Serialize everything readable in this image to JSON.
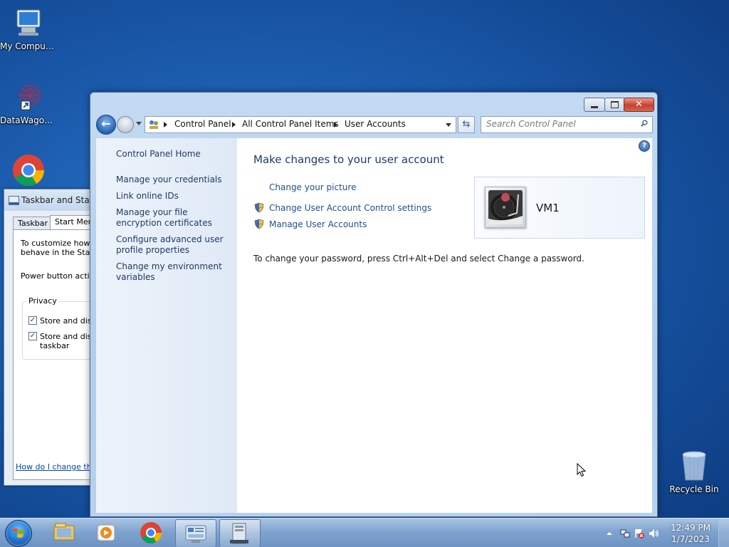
{
  "desktop": {
    "icons": [
      {
        "label": "My Computer",
        "icon": "computer-icon"
      },
      {
        "label": "DataWagon...",
        "icon": "datawagon-icon"
      },
      {
        "label": "",
        "icon": "chrome-icon"
      },
      {
        "label": "Recycle Bin",
        "icon": "recycle-bin-icon"
      }
    ]
  },
  "taskbar_props": {
    "title": "Taskbar and Start",
    "tabs": [
      "Taskbar",
      "Start Menu"
    ],
    "active_tab": "Start Menu",
    "desc_line1": "To customize how lin",
    "desc_line2": "behave in the Start",
    "power_label": "Power button action",
    "privacy_label": "Privacy",
    "checkbox1": "Store and displ",
    "checkbox2_line1": "Store and displ",
    "checkbox2_line2": "taskbar",
    "help_link": "How do I change the"
  },
  "window": {
    "address": {
      "crumbs": [
        "Control Panel",
        "All Control Panel Items",
        "User Accounts"
      ]
    },
    "search_placeholder": "Search Control Panel",
    "left_pane": {
      "home": "Control Panel Home",
      "links": [
        "Manage your credentials",
        "Link online IDs",
        "Manage your file encryption certificates",
        "Configure advanced user profile properties",
        "Change my environment variables"
      ]
    },
    "content": {
      "title": "Make changes to your user account",
      "tasks": [
        "Change your picture",
        "Change User Account Control settings",
        "Manage User Accounts"
      ],
      "account_name": "VM1",
      "password_info": "To change your password, press Ctrl+Alt+Del and select Change a password."
    }
  },
  "taskbar": {
    "time": "12:49 PM",
    "date": "1/7/2023",
    "apps": [
      "explorer-icon",
      "media-player-icon",
      "chrome-icon",
      "control-panel-icon",
      "user-accounts-icon"
    ]
  },
  "colors": {
    "link": "#1f4f8f",
    "heading": "#1e3a66",
    "desktop": "#1d5eb0"
  }
}
